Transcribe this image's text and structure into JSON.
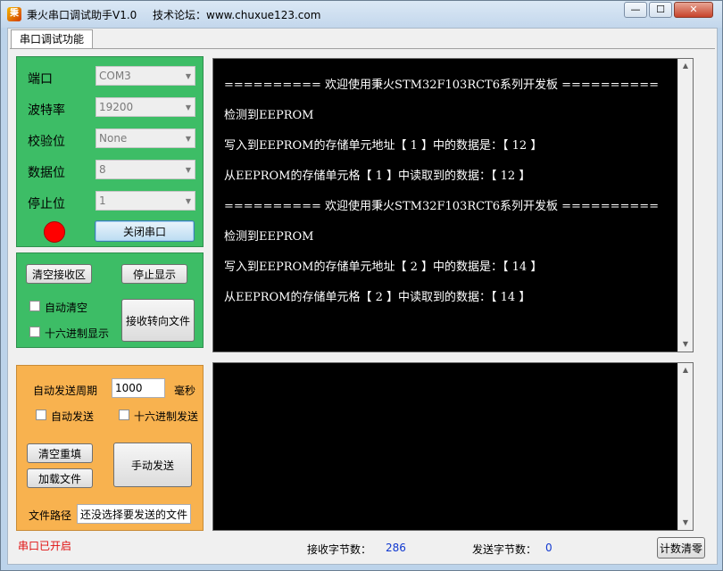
{
  "window": {
    "app_title": "秉火串口调试助手V1.0",
    "forum": "技术论坛：www.chuxue123.com",
    "minimize_glyph": "—",
    "maximize_glyph": "☐",
    "close_glyph": "✕"
  },
  "tab": {
    "label": "串口调试功能"
  },
  "serial_settings": {
    "port_label": "端口",
    "port_value": "COM3",
    "baud_label": "波特率",
    "baud_value": "19200",
    "parity_label": "校验位",
    "parity_value": "None",
    "databits_label": "数据位",
    "databits_value": "8",
    "stopbits_label": "停止位",
    "stopbits_value": "1",
    "status_color": "#ff0000",
    "close_port_button": "关闭串口"
  },
  "receive_controls": {
    "clear_button": "清空接收区",
    "stop_display_button": "停止显示",
    "auto_clear_label": "自动清空",
    "hex_display_label": "十六进制显示",
    "to_file_button": "接收转向文件"
  },
  "send_controls": {
    "period_label": "自动发送周期",
    "period_value": "1000",
    "period_unit": "毫秒",
    "auto_send_label": "自动发送",
    "hex_send_label": "十六进制发送",
    "clear_refill_button": "清空重填",
    "load_file_button": "加载文件",
    "manual_send_button": "手动发送",
    "file_path_label": "文件路径",
    "file_path_value": "还没选择要发送的文件"
  },
  "receive_area": {
    "lines": [
      "========== 欢迎使用秉火STM32F103RCT6系列开发板 ==========",
      "检测到EEPROM",
      "写入到EEPROM的存储单元地址【 1 】中的数据是：【 12 】",
      "从EEPROM的存储单元格【 1 】中读取到的数据：【 12 】",
      "========== 欢迎使用秉火STM32F103RCT6系列开发板 ==========",
      "检测到EEPROM",
      "写入到EEPROM的存储单元地址【 2 】中的数据是：【 14 】",
      "从EEPROM的存储单元格【 2 】中读取到的数据：【 14 】"
    ]
  },
  "status_bar": {
    "port_status": "串口已开启",
    "rx_label": "接收字节数：",
    "rx_count": "286",
    "tx_label": "发送字节数：",
    "tx_count": "0",
    "reset_button": "计数清零"
  }
}
